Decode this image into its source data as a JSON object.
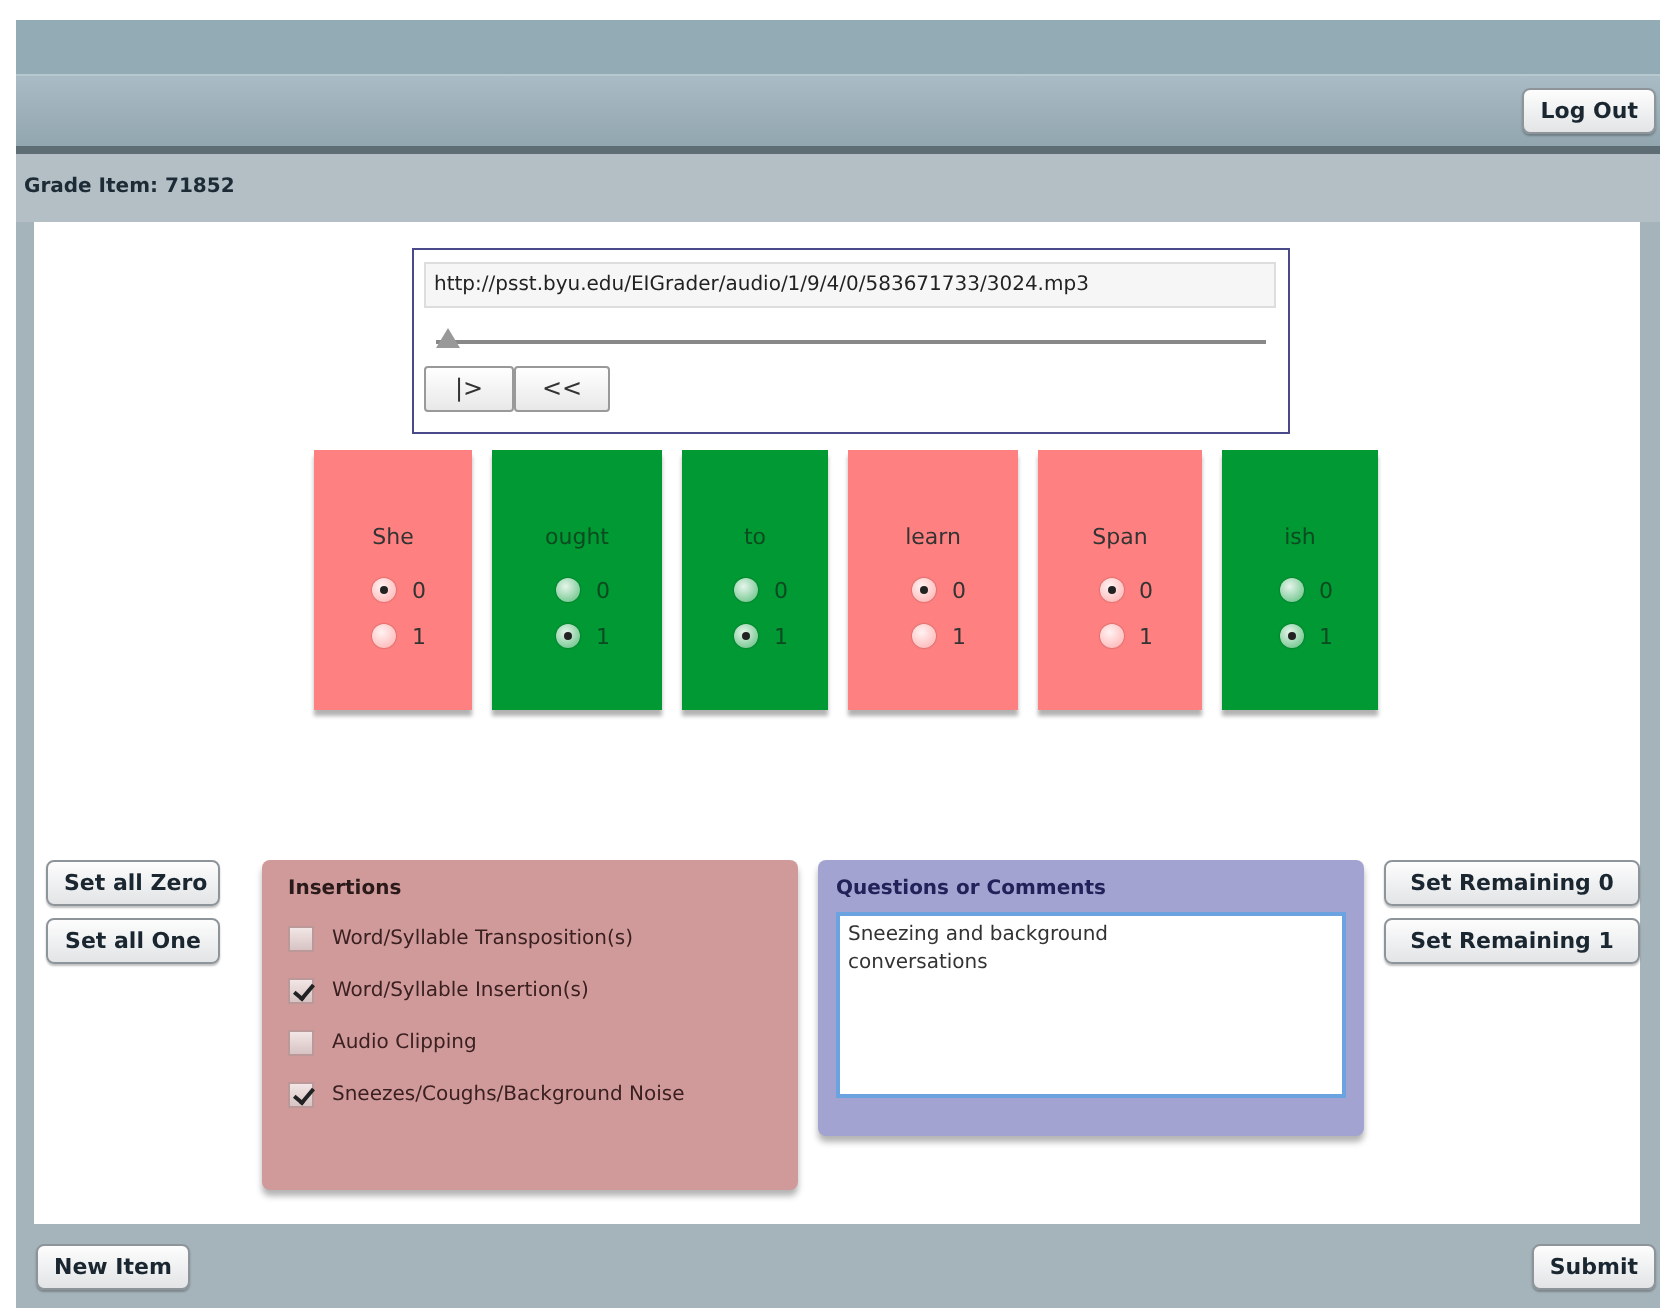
{
  "header": {
    "logout_button": "Log Out"
  },
  "grade_item": "Grade Item: 71852",
  "player": {
    "url": "http://psst.byu.edu/EIGrader/audio/1/9/4/0/583671733/3024.mp3",
    "level": 0.0,
    "buttons": [
      "|>",
      "<<"
    ]
  },
  "words": [
    {
      "word": "She",
      "options": [
        {
          "label": "0",
          "selected": true
        },
        {
          "label": "1",
          "selected": false
        }
      ]
    },
    {
      "word": "ought",
      "options": [
        {
          "label": "0",
          "selected": false
        },
        {
          "label": "1",
          "selected": true
        }
      ]
    },
    {
      "word": "to",
      "options": [
        {
          "label": "0",
          "selected": false
        },
        {
          "label": "1",
          "selected": true
        }
      ]
    },
    {
      "word": "learn",
      "options": [
        {
          "label": "0",
          "selected": true
        },
        {
          "label": "1",
          "selected": false
        }
      ]
    },
    {
      "word": "Span",
      "options": [
        {
          "label": "0",
          "selected": true
        },
        {
          "label": "1",
          "selected": false
        }
      ]
    },
    {
      "word": "ish",
      "options": [
        {
          "label": "0",
          "selected": false
        },
        {
          "label": "1",
          "selected": true
        }
      ]
    }
  ],
  "left_buttons": [
    "Set all Zero",
    "Set all One"
  ],
  "insertions": {
    "title": "Insertions",
    "items": [
      {
        "label": "Word/Syllable Transposition(s)",
        "checked": false
      },
      {
        "label": "Word/Syllable Insertion(s)",
        "checked": true
      },
      {
        "label": "Audio Clipping",
        "checked": false
      },
      {
        "label": "Sneezes/Coughs/Background Noise",
        "checked": true
      }
    ]
  },
  "comments": {
    "title": "Questions or Comments",
    "value": "Sneezing and background\nconversations"
  },
  "right_buttons": [
    "Set Remaining 0",
    "Set Remaining 1"
  ],
  "footer": {
    "new_item_button": "New Item",
    "submit_button": "Submit"
  }
}
